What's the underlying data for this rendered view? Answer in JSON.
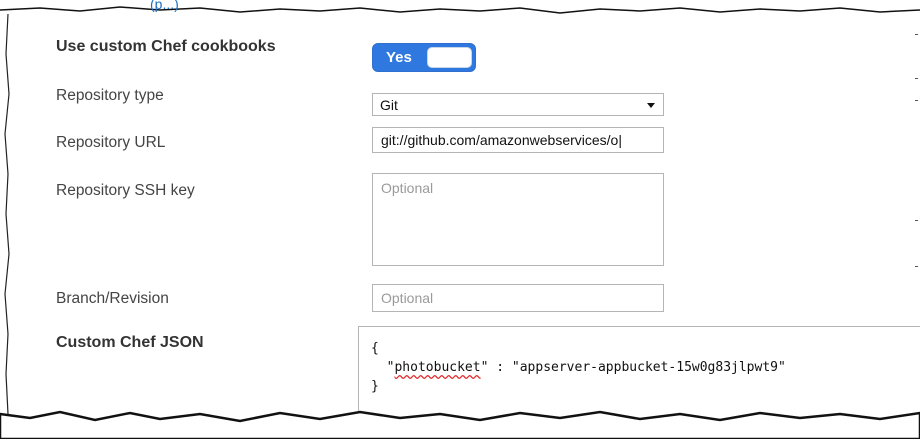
{
  "clipped_link": "(p...)",
  "form": {
    "custom_cookbooks": {
      "label": "Use custom Chef cookbooks",
      "toggle_label": "Yes"
    },
    "repository_type": {
      "label": "Repository type",
      "value": "Git"
    },
    "repository_url": {
      "label": "Repository URL",
      "value": "git://github.com/amazonwebservices/o|"
    },
    "ssh_key": {
      "label": "Repository SSH key",
      "placeholder": "Optional"
    },
    "branch": {
      "label": "Branch/Revision",
      "placeholder": "Optional"
    },
    "custom_json": {
      "label": "Custom Chef JSON",
      "line_open": "{",
      "line_key_prefix": "  \"",
      "key": "photobucket",
      "line_value": "\" : \"appserver-appbucket-15w0g83jlpwt9\"",
      "line_close": "}"
    }
  },
  "colors": {
    "toggle": "#2f78e0",
    "link": "#1a6fc4"
  }
}
